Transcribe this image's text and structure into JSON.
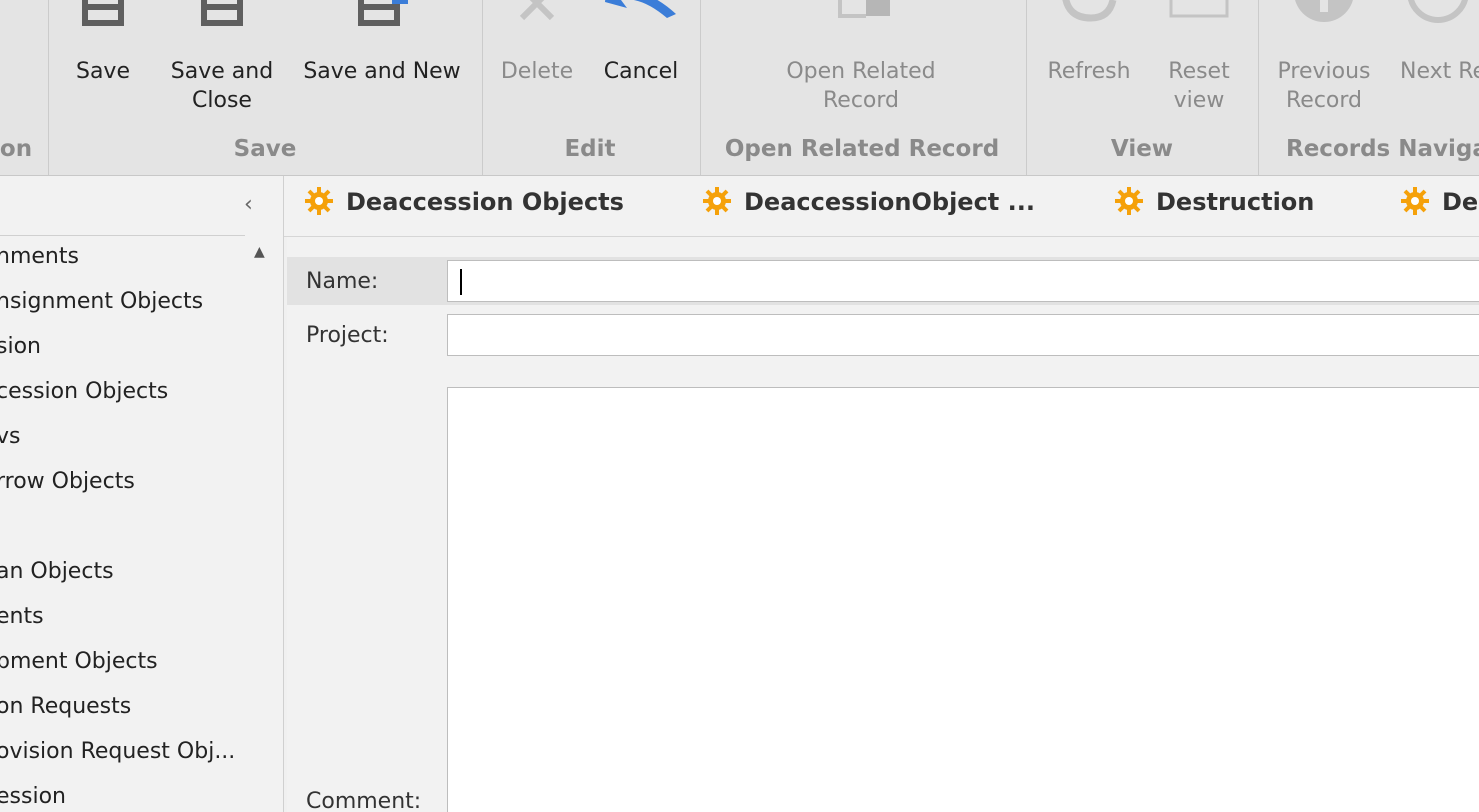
{
  "ribbon": {
    "groups": {
      "left_partial": "on",
      "save": "Save",
      "edit": "Edit",
      "open_related": "Open Related Record",
      "view": "View",
      "records_navigation": "Records Naviga"
    },
    "buttons": {
      "save": "Save",
      "save_and_close_1": "Save and",
      "save_and_close_2": "Close",
      "save_and_new": "Save and New",
      "delete": "Delete",
      "cancel": "Cancel",
      "open_related_1": "Open Related",
      "open_related_2": "Record",
      "refresh": "Refresh",
      "reset_view_1": "Reset",
      "reset_view_2": "view",
      "previous_record_1": "Previous",
      "previous_record_2": "Record",
      "next_record": "Next Re"
    },
    "icons": {
      "save": "floppy-icon",
      "save_and_close": "floppy-icon",
      "save_and_new": "floppy-new-icon",
      "delete": "x-icon",
      "cancel": "undo-arrow-icon",
      "open_related": "open-record-icon",
      "refresh": "refresh-icon",
      "reset_view": "reset-view-icon",
      "previous_record": "circle-previous-icon",
      "next_record": "circle-next-icon"
    },
    "colors": {
      "accent_blue": "#3b7dd8",
      "disabled": "#8a8a8a"
    }
  },
  "nav": {
    "items": [
      "nments",
      "nsignment Objects",
      "sion",
      "cession Objects",
      "vs",
      "rrow Objects",
      "an Objects",
      "ents",
      "pment Objects",
      "on Requests",
      "ovision Request Obj...",
      "ession"
    ]
  },
  "tabs": [
    {
      "label": "Deaccession Objects"
    },
    {
      "label": "DeaccessionObject ..."
    },
    {
      "label": "Destruction"
    },
    {
      "label": "Des"
    }
  ],
  "tab_icon_color": "#f5a10a",
  "form": {
    "name_label": "Name:",
    "name_value": "",
    "project_label": "Project:",
    "project_value": "",
    "comment_label": "Comment:",
    "comment_value": ""
  }
}
